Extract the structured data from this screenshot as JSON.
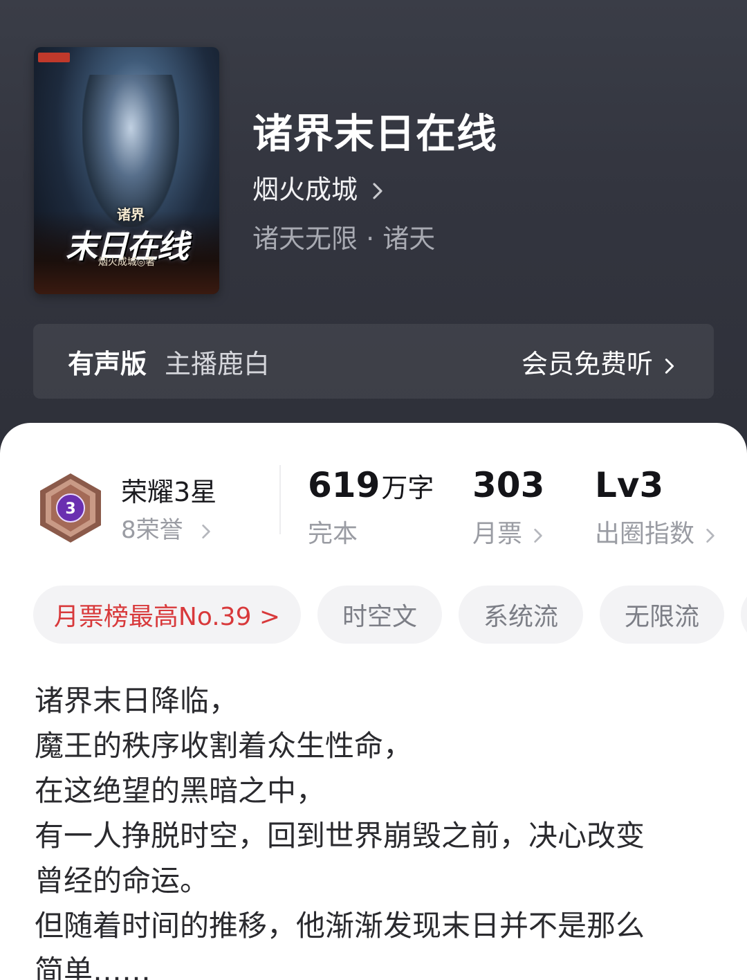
{
  "header": {
    "book_title": "诸界末日在线",
    "author": "烟火成城",
    "genre": "诸天无限 · 诸天",
    "cover": {
      "subtitle": "诸界",
      "title": "末日在线",
      "author_line": "烟火成城◎著"
    }
  },
  "audio": {
    "label": "有声版",
    "host": "主播鹿白",
    "cta": "会员免费听"
  },
  "stats": {
    "honor": {
      "title": "荣耀3星",
      "sub": "8荣誉",
      "badge_level": "3"
    },
    "words": {
      "value": "619",
      "unit": "万字",
      "label": "完本"
    },
    "monthly": {
      "value": "303",
      "label": "月票"
    },
    "influence": {
      "value": "Lv3",
      "label": "出圈指数"
    }
  },
  "tags": [
    {
      "label": "月票榜最高No.39 >"
    },
    {
      "label": "时空文"
    },
    {
      "label": "系统流"
    },
    {
      "label": "无限流"
    }
  ],
  "blurb": [
    "诸界末日降临，",
    "魔王的秩序收割着众生性命，",
    "在这绝望的黑暗之中，",
    "有一人挣脱时空，回到世界崩毁之前，决心改变",
    "曾经的命运。",
    "但随着时间的推移，他渐渐发现末日并不是那么",
    "简单……"
  ],
  "colors": {
    "header_bg": "#33353f",
    "accent_red": "#d8393b",
    "badge_purple": "#6a2fb0"
  }
}
